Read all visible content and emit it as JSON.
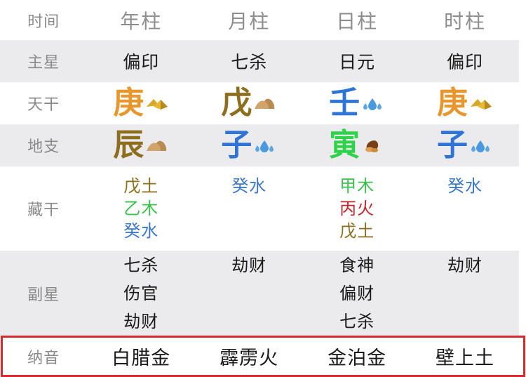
{
  "header": {
    "row_label": "时间",
    "columns": [
      "年柱",
      "月柱",
      "日柱",
      "时柱"
    ]
  },
  "main_star": {
    "label": "主星",
    "values": [
      "偏印",
      "七杀",
      "日元",
      "偏印"
    ]
  },
  "heavenly_stem": {
    "label": "天干",
    "values": [
      {
        "char": "庚",
        "element": "metal",
        "color": "#e8962e",
        "icon": "gold-pyramid-icon"
      },
      {
        "char": "戊",
        "element": "earth",
        "color": "#8d6e1e",
        "icon": "mountain-icon"
      },
      {
        "char": "壬",
        "element": "water",
        "color": "#2f73d6",
        "icon": "water-drops-icon"
      },
      {
        "char": "庚",
        "element": "metal",
        "color": "#e8962e",
        "icon": "gold-pyramid-icon"
      }
    ]
  },
  "earthly_branch": {
    "label": "地支",
    "values": [
      {
        "char": "辰",
        "element": "earth",
        "color": "#8d6e1e",
        "icon": "mountain-icon"
      },
      {
        "char": "子",
        "element": "water",
        "color": "#2f73d6",
        "icon": "water-drops-icon"
      },
      {
        "char": "寅",
        "element": "wood",
        "color": "#2ed34a",
        "icon": "wood-log-icon"
      },
      {
        "char": "子",
        "element": "water",
        "color": "#2f73d6",
        "icon": "water-drops-icon"
      }
    ]
  },
  "hidden_stems": {
    "label": "藏干",
    "columns": [
      [
        {
          "text": "戊土",
          "color": "#8d6e1e"
        },
        {
          "text": "乙木",
          "color": "#3cc04e"
        },
        {
          "text": "癸水",
          "color": "#3c78c8"
        }
      ],
      [
        {
          "text": "癸水",
          "color": "#3c78c8"
        }
      ],
      [
        {
          "text": "甲木",
          "color": "#3cc04e"
        },
        {
          "text": "丙火",
          "color": "#c0282e"
        },
        {
          "text": "戊土",
          "color": "#8d6e1e"
        }
      ],
      [
        {
          "text": "癸水",
          "color": "#3c78c8"
        }
      ]
    ]
  },
  "sub_stars": {
    "label": "副星",
    "columns": [
      [
        "七杀",
        "伤官",
        "劫财"
      ],
      [
        "劫财"
      ],
      [
        "食神",
        "偏财",
        "七杀"
      ],
      [
        "劫财"
      ]
    ]
  },
  "nayin": {
    "label": "纳音",
    "values": [
      "白腊金",
      "霹雳火",
      "金泊金",
      "壁上土"
    ],
    "highlight_color": "#d62a2f"
  }
}
